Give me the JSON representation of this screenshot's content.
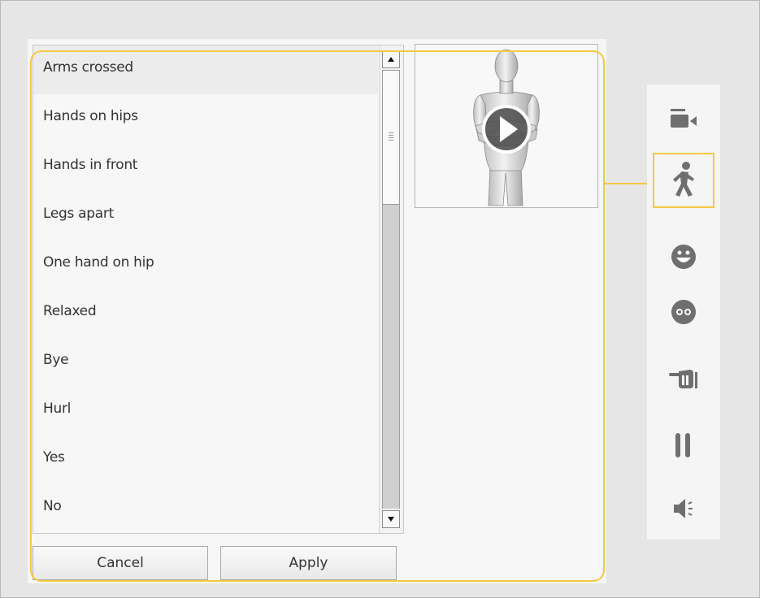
{
  "gesture_list": {
    "selected_index": 0,
    "items": [
      {
        "label": "Arms crossed"
      },
      {
        "label": "Hands on hips"
      },
      {
        "label": "Hands in front"
      },
      {
        "label": "Legs apart"
      },
      {
        "label": "One hand on hip"
      },
      {
        "label": "Relaxed"
      },
      {
        "label": "Bye"
      },
      {
        "label": "Hurl"
      },
      {
        "label": "Yes"
      },
      {
        "label": "No"
      }
    ]
  },
  "buttons": {
    "cancel_label": "Cancel",
    "apply_label": "Apply"
  },
  "preview": {
    "figure_icon": "mannequin-figure",
    "overlay_icon": "play-icon"
  },
  "toolbar": {
    "active": "gesture",
    "items": [
      {
        "icon": "camera-icon"
      },
      {
        "icon": "walking-person-icon"
      },
      {
        "icon": "smiley-face-icon"
      },
      {
        "icon": "eyes-face-icon"
      },
      {
        "icon": "pointing-hand-icon"
      },
      {
        "icon": "pause-icon"
      },
      {
        "icon": "speaker-icon"
      }
    ]
  },
  "colors": {
    "highlight": "#f5c842",
    "icon": "#6f6f6f",
    "background": "#e6e6e6"
  }
}
